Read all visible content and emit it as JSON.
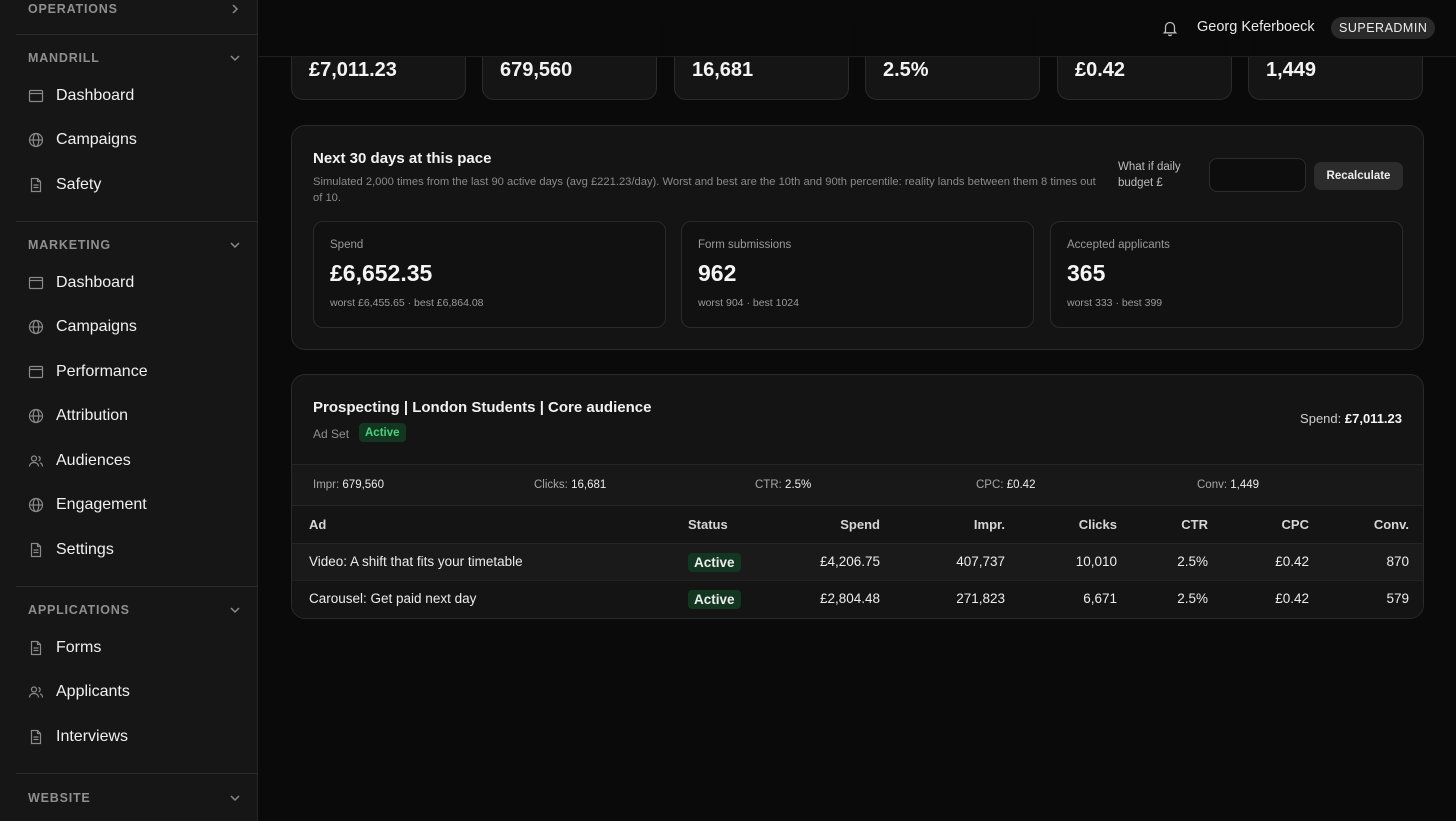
{
  "sidebar": {
    "operations": {
      "title": "OPERATIONS"
    },
    "mandrill": {
      "title": "MANDRILL",
      "items": [
        {
          "label": "Dashboard",
          "icon": "layout-icon"
        },
        {
          "label": "Campaigns",
          "icon": "globe-icon"
        },
        {
          "label": "Safety",
          "icon": "document-icon"
        }
      ]
    },
    "marketing": {
      "title": "MARKETING",
      "items": [
        {
          "label": "Dashboard",
          "icon": "layout-icon"
        },
        {
          "label": "Campaigns",
          "icon": "globe-icon"
        },
        {
          "label": "Performance",
          "icon": "layout-icon"
        },
        {
          "label": "Attribution",
          "icon": "globe-icon"
        },
        {
          "label": "Audiences",
          "icon": "users-icon"
        },
        {
          "label": "Engagement",
          "icon": "globe-icon"
        },
        {
          "label": "Settings",
          "icon": "document-icon"
        }
      ]
    },
    "applications": {
      "title": "APPLICATIONS",
      "items": [
        {
          "label": "Forms",
          "icon": "document-icon"
        },
        {
          "label": "Applicants",
          "icon": "users-icon"
        },
        {
          "label": "Interviews",
          "icon": "document-icon"
        }
      ]
    },
    "website": {
      "title": "WEBSITE"
    }
  },
  "topbar": {
    "user_name": "Georg Keferboeck",
    "role": "SUPERADMIN"
  },
  "stats": [
    {
      "value": "£7,011.23"
    },
    {
      "value": "679,560"
    },
    {
      "value": "16,681"
    },
    {
      "value": "2.5%"
    },
    {
      "value": "£0.42"
    },
    {
      "value": "1,449"
    }
  ],
  "forecast": {
    "title": "Next 30 days at this pace",
    "description": "Simulated 2,000 times from the last 90 active days (avg £221.23/day). Worst and best are the 10th and 90th percentile: reality lands between them 8 times out of 10.",
    "whatif_label": "What if daily budget £",
    "budget_value": "",
    "budget_placeholder": "",
    "recalculate_label": "Recalculate",
    "cards": [
      {
        "label": "Spend",
        "value": "£6,652.35",
        "range": "worst £6,455.65 · best £6,864.08"
      },
      {
        "label": "Form submissions",
        "value": "962",
        "range": "worst 904 · best 1024"
      },
      {
        "label": "Accepted applicants",
        "value": "365",
        "range": "worst 333 · best 399"
      }
    ]
  },
  "adset": {
    "name": "Prospecting | London Students | Core audience",
    "type": "Ad Set",
    "status": "Active",
    "spend_label": "Spend:",
    "spend_value": "£7,011.23",
    "metrics": [
      {
        "label": "Impr:",
        "value": "679,560"
      },
      {
        "label": "Clicks:",
        "value": "16,681"
      },
      {
        "label": "CTR:",
        "value": "2.5%"
      },
      {
        "label": "CPC:",
        "value": "£0.42"
      },
      {
        "label": "Conv:",
        "value": "1,449"
      }
    ],
    "columns": [
      "Ad",
      "Status",
      "Spend",
      "Impr.",
      "Clicks",
      "CTR",
      "CPC",
      "Conv."
    ],
    "rows": [
      {
        "ad": "Video: A shift that fits your timetable",
        "status": "Active",
        "spend": "£4,206.75",
        "impr": "407,737",
        "clicks": "10,010",
        "ctr": "2.5%",
        "cpc": "£0.42",
        "conv": "870"
      },
      {
        "ad": "Carousel: Get paid next day",
        "status": "Active",
        "spend": "£2,804.48",
        "impr": "271,823",
        "clicks": "6,671",
        "ctr": "2.5%",
        "cpc": "£0.42",
        "conv": "579"
      }
    ]
  },
  "colors": {
    "accent_green": "#4ad17a",
    "badge_bg": "#12361f",
    "background": "#0a0a0a",
    "panel": "#141414"
  }
}
